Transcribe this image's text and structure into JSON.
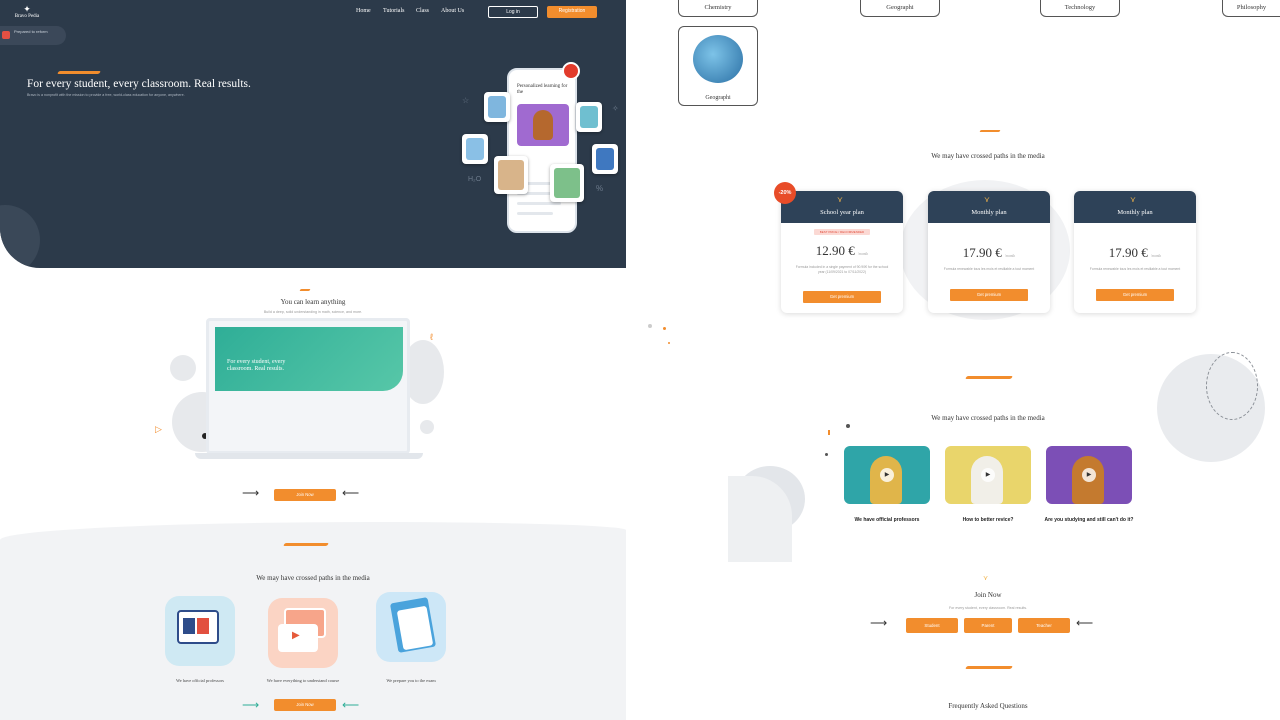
{
  "header": {
    "logo_text": "Bravo Pedia",
    "nav": [
      "Home",
      "Tutorials",
      "Class",
      "About Us"
    ],
    "login": "Log in",
    "register": "Registration"
  },
  "pill": {
    "text": "Prepared to reform"
  },
  "hero": {
    "title": "For every student, every classroom. Real results.",
    "subtitle": "Bravo is a nonprofit with the mission to provide a free, world-class education for anyone, anywhere.",
    "phone_title": "Personalized learning for the"
  },
  "learn": {
    "title": "You can learn anything",
    "subtitle": "Build a deep, solid understanding in math, science, and more.",
    "laptop_heading": "For every student, every classroom. Real results.",
    "join_label": "Join Now"
  },
  "media1": {
    "title": "We may have crossed paths in the media",
    "features": [
      {
        "label": "We have official professors",
        "icon": "professor-icon"
      },
      {
        "label": "We have everything to understand course",
        "icon": "video-course-icon"
      },
      {
        "label": "We prepare you to the exam",
        "icon": "exam-doc-icon"
      }
    ],
    "join_label": "Join Now"
  },
  "categories": [
    "Chemistry",
    "Geographi",
    "Technology",
    "Philosophy"
  ],
  "category_card": {
    "label": "Geographi",
    "icon": "globe-icon"
  },
  "pricing": {
    "title": "We may have crossed paths in the media",
    "discount": "-20%",
    "plans": [
      {
        "name": "School year plan",
        "price": "12.90 €",
        "unit": "/month",
        "desc": "Formula included in a single payment of 90.90€ for the school year (11/09/2021 to 07/11/2022)",
        "cta": "Get premium",
        "tag": "BEST PRICE / RECOMMENDED"
      },
      {
        "name": "Monthly plan",
        "price": "17.90 €",
        "unit": "/month",
        "desc": "Formula renewable tous les mois et resiliable a tout moment",
        "cta": "Get premium"
      },
      {
        "name": "Monthly plan",
        "price": "17.90 €",
        "unit": "/month",
        "desc": "Formula renewable tous les mois et resiliable a tout moment",
        "cta": "Get premium"
      }
    ]
  },
  "media2": {
    "title": "We may have crossed paths in the media",
    "videos": [
      {
        "label": "We have official professors",
        "bg": "#2fa5a8"
      },
      {
        "label": "How to better revice?",
        "bg": "#e9d56b"
      },
      {
        "label": "Are you studying and still can't do it?",
        "bg": "#7c4fb6"
      }
    ]
  },
  "join": {
    "title": "Join Now",
    "subtitle": "For every student, every classroom. Real results.",
    "roles": [
      "Student",
      "Parent",
      "Teacher"
    ]
  },
  "faq": {
    "title": "Frequently Asked Questions"
  },
  "colors": {
    "accent": "#f28d2d",
    "navy": "#2c3a4a"
  }
}
